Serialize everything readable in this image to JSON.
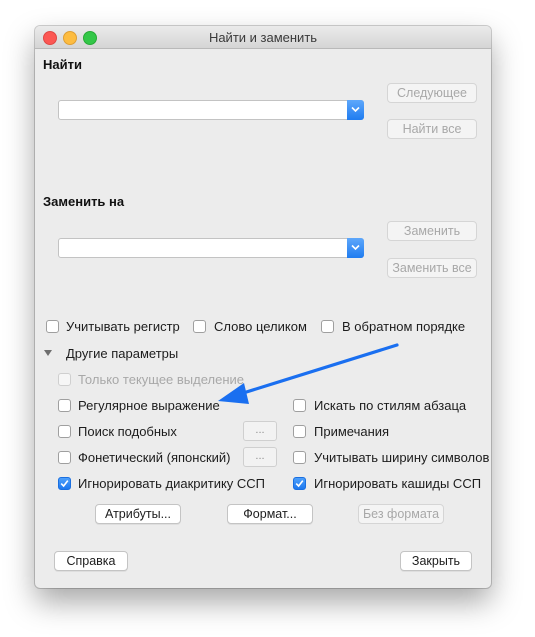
{
  "window": {
    "title": "Найти и заменить"
  },
  "find": {
    "label": "Найти",
    "value": "",
    "next_button": "Следующее",
    "find_all_button": "Найти все"
  },
  "replace": {
    "label": "Заменить на",
    "value": "",
    "replace_button": "Заменить",
    "replace_all_button": "Заменить все"
  },
  "options": {
    "match_case": {
      "label": "Учитывать регистр",
      "checked": false
    },
    "whole_word": {
      "label": "Слово целиком",
      "checked": false
    },
    "reverse": {
      "label": "В обратном порядке",
      "checked": false
    }
  },
  "more": {
    "label": "Другие параметры",
    "selection_only": {
      "label": "Только текущее выделение",
      "checked": false,
      "enabled": false
    },
    "regex": {
      "label": "Регулярное выражение",
      "checked": false
    },
    "similar": {
      "label": "Поиск подобных",
      "checked": false
    },
    "phonetic": {
      "label": "Фонетический (японский)",
      "checked": false
    },
    "diacritics": {
      "label": "Игнорировать диакритику ССП",
      "checked": true
    },
    "paragraph_styles": {
      "label": "Искать по стилям абзаца",
      "checked": false
    },
    "notes": {
      "label": "Примечания",
      "checked": false
    },
    "char_width": {
      "label": "Учитывать ширину символов",
      "checked": false
    },
    "kashida": {
      "label": "Игнорировать кашиды ССП",
      "checked": true
    },
    "more_button": "..."
  },
  "format_buttons": {
    "attributes": "Атрибуты...",
    "format": "Формат...",
    "no_format": "Без формата"
  },
  "footer": {
    "help": "Справка",
    "close": "Закрыть"
  },
  "colors": {
    "accent": "#1f7cf0",
    "arrow": "#1a6ff0"
  }
}
